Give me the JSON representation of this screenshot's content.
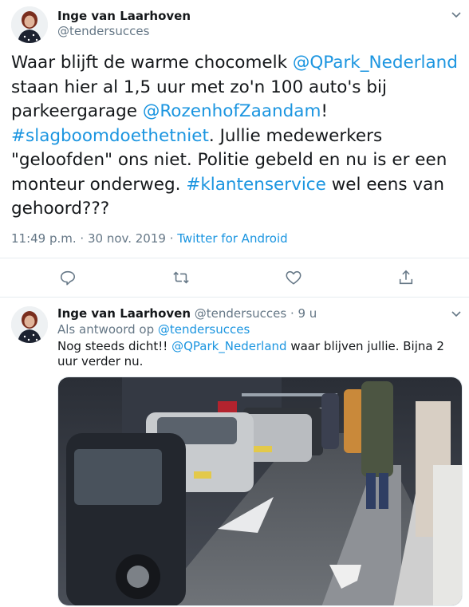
{
  "tweet": {
    "author_name": "Inge van Laarhoven",
    "author_handle": "@tendersucces",
    "text": [
      {
        "t": "Waar blijft de warme chocomelk ",
        "link": false
      },
      {
        "t": "@QPark_Nederland",
        "link": true
      },
      {
        "t": " staan hier al 1,5 uur met zo'n 100 auto's bij parkeergarage ",
        "link": false
      },
      {
        "t": "@RozenhofZaandam",
        "link": true
      },
      {
        "t": "! ",
        "link": false
      },
      {
        "t": "#slagboomdoethetniet",
        "link": true
      },
      {
        "t": ". Jullie medewerkers \"geloofden\" ons niet. Politie gebeld en nu is er een monteur onderweg. ",
        "link": false
      },
      {
        "t": "#klantenservice",
        "link": true
      },
      {
        "t": " wel eens van gehoord???",
        "link": false
      }
    ],
    "time": "11:49 p.m. · 30 nov. 2019 · ",
    "app": "Twitter for Android",
    "actions": [
      "reply-icon",
      "retweet-icon",
      "like-icon",
      "share-icon"
    ]
  },
  "reply": {
    "author_name": "Inge van Laarhoven",
    "author_handle": "@tendersucces · 9 u",
    "reply_prefix": "Als antwoord op ",
    "reply_to": "@tendersucces",
    "text": [
      {
        "t": "Nog steeds dicht!! ",
        "link": false
      },
      {
        "t": "@QPark_Nederland",
        "link": true
      },
      {
        "t": " waar blijven jullie. Bijna 2 uur verder nu.",
        "link": false
      }
    ]
  },
  "colors": {
    "link": "#1b95e0",
    "muted": "#657786",
    "divider": "#e6ecf0"
  }
}
